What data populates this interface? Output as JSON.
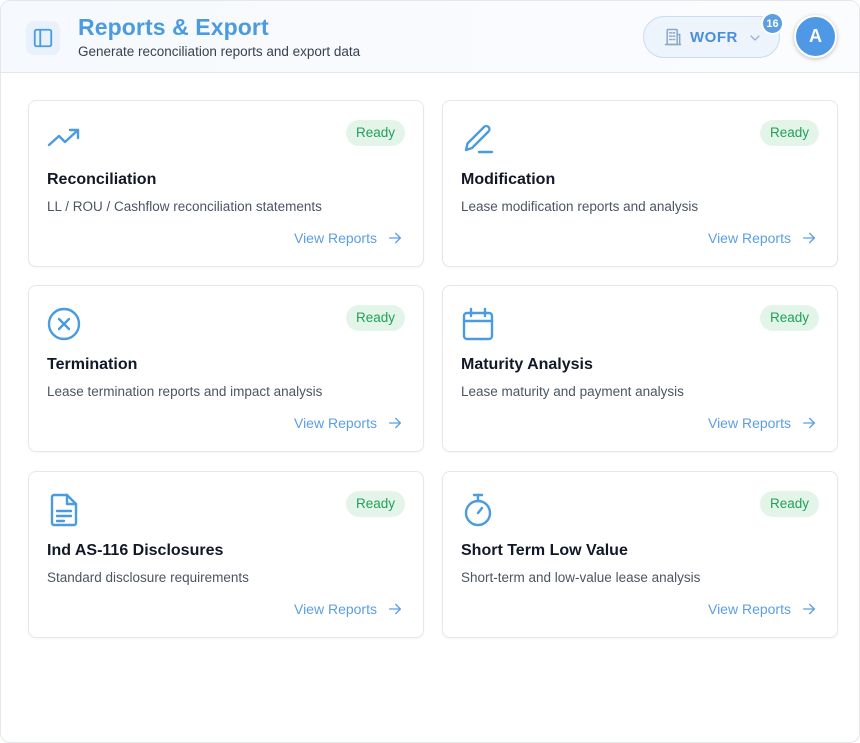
{
  "header": {
    "title": "Reports & Export",
    "subtitle": "Generate reconciliation reports and export data",
    "org_selector": {
      "value": "WOFR",
      "icon": "building-icon"
    },
    "notification_count": "16",
    "avatar_initial": "A"
  },
  "colors": {
    "accent": "#4a9be0",
    "ready_bg": "#e3f5e8",
    "ready_text": "#22a05a",
    "link": "#5a9ee6"
  },
  "cards": [
    {
      "title": "Reconciliation",
      "description": "LL / ROU / Cashflow reconciliation statements",
      "status": "Ready",
      "link": "View Reports",
      "icon": "trending-up-icon"
    },
    {
      "title": "Modification",
      "description": "Lease modification reports and analysis",
      "status": "Ready",
      "link": "View Reports",
      "icon": "pen-icon"
    },
    {
      "title": "Termination",
      "description": "Lease termination reports and impact analysis",
      "status": "Ready",
      "link": "View Reports",
      "icon": "x-circle-icon"
    },
    {
      "title": "Maturity Analysis",
      "description": "Lease maturity and payment analysis",
      "status": "Ready",
      "link": "View Reports",
      "icon": "calendar-icon"
    },
    {
      "title": "Ind AS-116 Disclosures",
      "description": "Standard disclosure requirements",
      "status": "Ready",
      "link": "View Reports",
      "icon": "document-icon"
    },
    {
      "title": "Short Term Low Value",
      "description": "Short-term and low-value lease analysis",
      "status": "Ready",
      "link": "View Reports",
      "icon": "stopwatch-icon"
    }
  ]
}
